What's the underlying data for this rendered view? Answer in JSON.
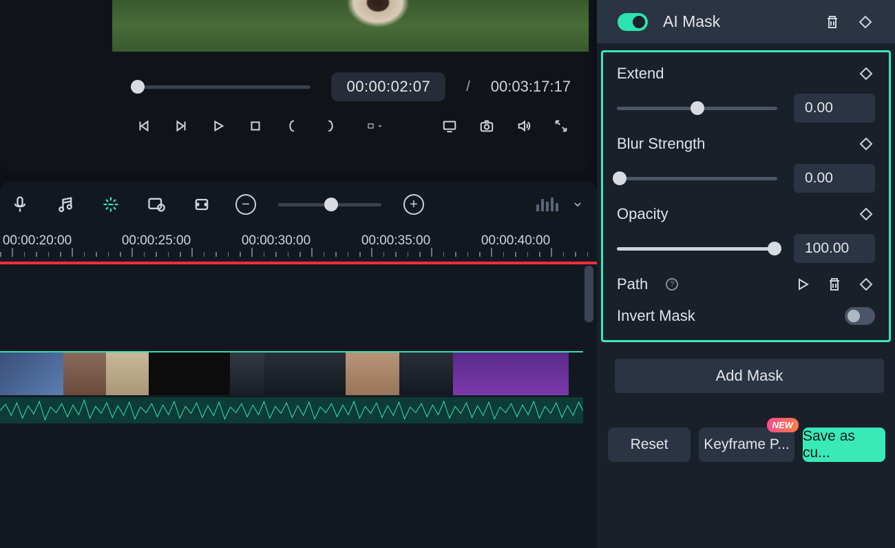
{
  "preview": {
    "current_time": "00:00:02:07",
    "separator": "/",
    "duration": "00:03:17:17"
  },
  "timeline": {
    "ruler_labels": [
      "00:00:20:00",
      "00:00:25:00",
      "00:00:30:00",
      "00:00:35:00",
      "00:00:40:00"
    ]
  },
  "side": {
    "title": "AI Mask",
    "ai_mask_enabled": true,
    "extend": {
      "label": "Extend",
      "value": "0.00",
      "percent": 50
    },
    "blur": {
      "label": "Blur Strength",
      "value": "0.00",
      "percent": 0
    },
    "opacity": {
      "label": "Opacity",
      "value": "100.00",
      "percent": 100
    },
    "path": {
      "label": "Path"
    },
    "invert": {
      "label": "Invert Mask",
      "enabled": false
    },
    "add_mask": "Add Mask",
    "reset": "Reset",
    "keyframe": "Keyframe P...",
    "keyframe_badge": "NEW",
    "save": "Save as cu..."
  }
}
